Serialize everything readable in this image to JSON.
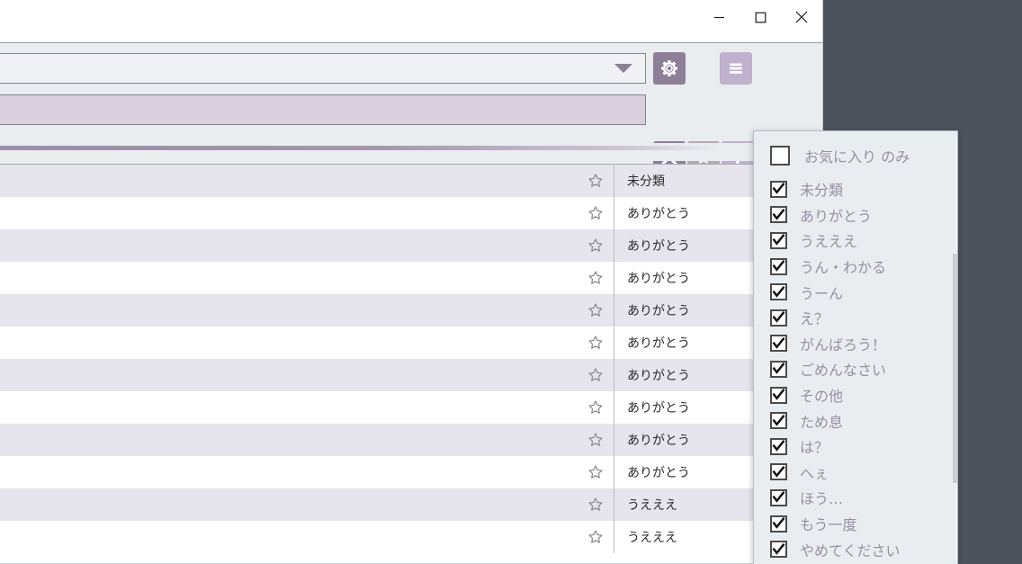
{
  "window": {
    "background_color": "#4d535c",
    "surface_color": "#eaedf0",
    "titlebar_color": "#ffffff",
    "controls": [
      {
        "name": "minimize",
        "glyph": "—"
      },
      {
        "name": "maximize",
        "glyph": "□"
      },
      {
        "name": "close",
        "glyph": "✕"
      }
    ]
  },
  "toolbar": {
    "combo_value": "",
    "combo_arrow_icon": "chevron-down-icon",
    "search_value": "",
    "search_placeholder": "",
    "buttons": [
      {
        "name": "settings",
        "icon": "gear-icon",
        "color": "#8d7f96"
      },
      {
        "name": "menu",
        "icon": "hamburger-icon",
        "color": "#c0b2cc"
      },
      {
        "name": "clear",
        "icon": "close-x-icon",
        "color": "#8d7f96"
      },
      {
        "name": "favorite",
        "icon": "star-icon",
        "color": "#b5aab1"
      },
      {
        "name": "filter",
        "icon": "funnel-icon",
        "color": "#c0b2cc"
      }
    ]
  },
  "progress": {
    "fill_color": "#9c8ca8",
    "track_color": "#eaedf0"
  },
  "table": {
    "star_icon": "star-outline-icon",
    "row_alt_color": "#e6e4ec",
    "row_color": "#ffffff",
    "rows": [
      {
        "category": "未分類",
        "favorite": false
      },
      {
        "category": "ありがとう",
        "favorite": false
      },
      {
        "category": "ありがとう",
        "favorite": false
      },
      {
        "category": "ありがとう",
        "favorite": false
      },
      {
        "category": "ありがとう",
        "favorite": false
      },
      {
        "category": "ありがとう",
        "favorite": false
      },
      {
        "category": "ありがとう",
        "favorite": false
      },
      {
        "category": "ありがとう",
        "favorite": false
      },
      {
        "category": "ありがとう",
        "favorite": false
      },
      {
        "category": "ありがとう",
        "favorite": false
      },
      {
        "category": "うえええ",
        "favorite": false
      },
      {
        "category": "うえええ",
        "favorite": false
      }
    ]
  },
  "filter_panel": {
    "favorites_only": {
      "label": "お気に入り のみ",
      "checked": false
    },
    "items": [
      {
        "label": "未分類",
        "checked": true
      },
      {
        "label": "ありがとう",
        "checked": true
      },
      {
        "label": "うえええ",
        "checked": true
      },
      {
        "label": "うん・わかる",
        "checked": true
      },
      {
        "label": "うーん",
        "checked": true
      },
      {
        "label": "え？",
        "checked": true
      },
      {
        "label": "がんばろう！",
        "checked": true
      },
      {
        "label": "ごめんなさい",
        "checked": true
      },
      {
        "label": "その他",
        "checked": true
      },
      {
        "label": "ため息",
        "checked": true
      },
      {
        "label": "は？",
        "checked": true
      },
      {
        "label": "へぇ",
        "checked": true
      },
      {
        "label": "ほう…",
        "checked": true
      },
      {
        "label": "もう一度",
        "checked": true
      },
      {
        "label": "やめてください",
        "checked": true
      }
    ]
  }
}
